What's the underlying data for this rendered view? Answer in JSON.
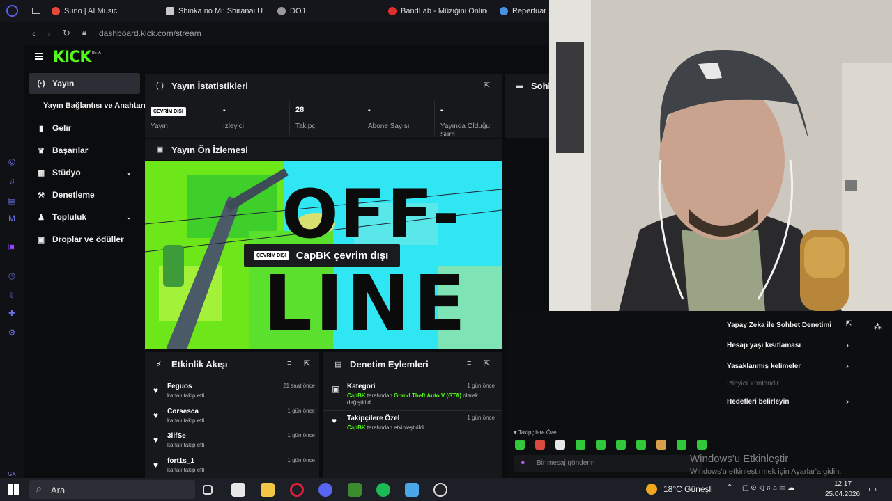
{
  "browser": {
    "tabs": [
      {
        "label": "Suno | AI Music",
        "color": "#e8483b"
      },
      {
        "label": "Shinka no Mi: Shiranai Uch",
        "color": "#c9c9c9"
      },
      {
        "label": "DOJ",
        "color": "#9a9a9a"
      },
      {
        "label": "BandLab - Müziğini Online",
        "color": "#e0302e"
      },
      {
        "label": "Repertuar",
        "color": "#4a90e2"
      }
    ],
    "url": "dashboard.kick.com/stream"
  },
  "kick": {
    "beta": "BETA",
    "sidebar": [
      {
        "label": "Yayın",
        "icon": "broadcast-icon"
      },
      {
        "label": "Yayın Bağlantısı ve Anahtarı"
      },
      {
        "label": "Gelir",
        "icon": "chart-icon"
      },
      {
        "label": "Başarılar",
        "icon": "trophy-icon"
      },
      {
        "label": "Stüdyo",
        "icon": "studio-icon"
      },
      {
        "label": "Denetleme",
        "icon": "hammer-icon"
      },
      {
        "label": "Topluluk",
        "icon": "people-icon"
      },
      {
        "label": "Droplar ve ödüller",
        "icon": "gift-icon"
      }
    ],
    "stats": {
      "title": "Yayın İstatistikleri",
      "badge": "ÇEVRİM DIŞI",
      "items": [
        {
          "value": "",
          "label": "Yayın"
        },
        {
          "value": "-",
          "label": "İzleyici"
        },
        {
          "value": "28",
          "label": "Takipçi"
        },
        {
          "value": "-",
          "label": "Abone Sayısı"
        },
        {
          "value": "-",
          "label": "Yayında Olduğu Süre"
        }
      ]
    },
    "chat_title": "Sohb",
    "preview": {
      "title": "Yayın Ön İzlemesi",
      "badge": "ÇEVRİM DIŞI",
      "text": "CapBK çevrim dışı",
      "big1": "OFF-",
      "big2": "LINE"
    },
    "activity": {
      "title": "Etkinlik Akışı",
      "rows": [
        {
          "name": "Feguos",
          "sub": "kanalı takip etti",
          "time": "21 saat önce"
        },
        {
          "name": "Corsesca",
          "sub": "kanalı takip etti",
          "time": "1 gün önce"
        },
        {
          "name": "3lifSe",
          "sub": "kanalı takip etti",
          "time": "1 gün önce"
        },
        {
          "name": "fort1s_1",
          "sub": "kanalı takip etti",
          "time": "1 gün önce"
        }
      ]
    },
    "moderation": {
      "title": "Denetim Eylemleri",
      "rows": [
        {
          "name": "Kategori",
          "user": "CapBK",
          "pre": " tarafından ",
          "game": "Grand Theft Auto V (GTA)",
          "post": " olarak değiştirildi",
          "time": "1 gün önce"
        },
        {
          "name": "Takipçilere Özel",
          "user": "CapBK",
          "pre": " tarafından etkinleştirildi",
          "time": "1 gün önce"
        }
      ]
    }
  },
  "chat_menu": {
    "items": [
      "Yapay Zeka ile Sohbet Denetimi",
      "Hesap yaşı kısıtlaması",
      "Yasaklanmış kelimeler",
      "İzleyici Yönlendir",
      "Hedefleri belirleyin"
    ],
    "followers_only": "Takipçilere Özel",
    "placeholder": "Bir mesaj gönderin"
  },
  "watermark": {
    "line1": "Windows'u Etkinleştir",
    "line2": "Windows'u etkinleştirmek için Ayarlar'a gidin."
  },
  "taskbar": {
    "search": "Ara",
    "weather": "18°C Güneşli",
    "time": "12:17",
    "date": "25.04.2026"
  },
  "gx_label": "GX"
}
